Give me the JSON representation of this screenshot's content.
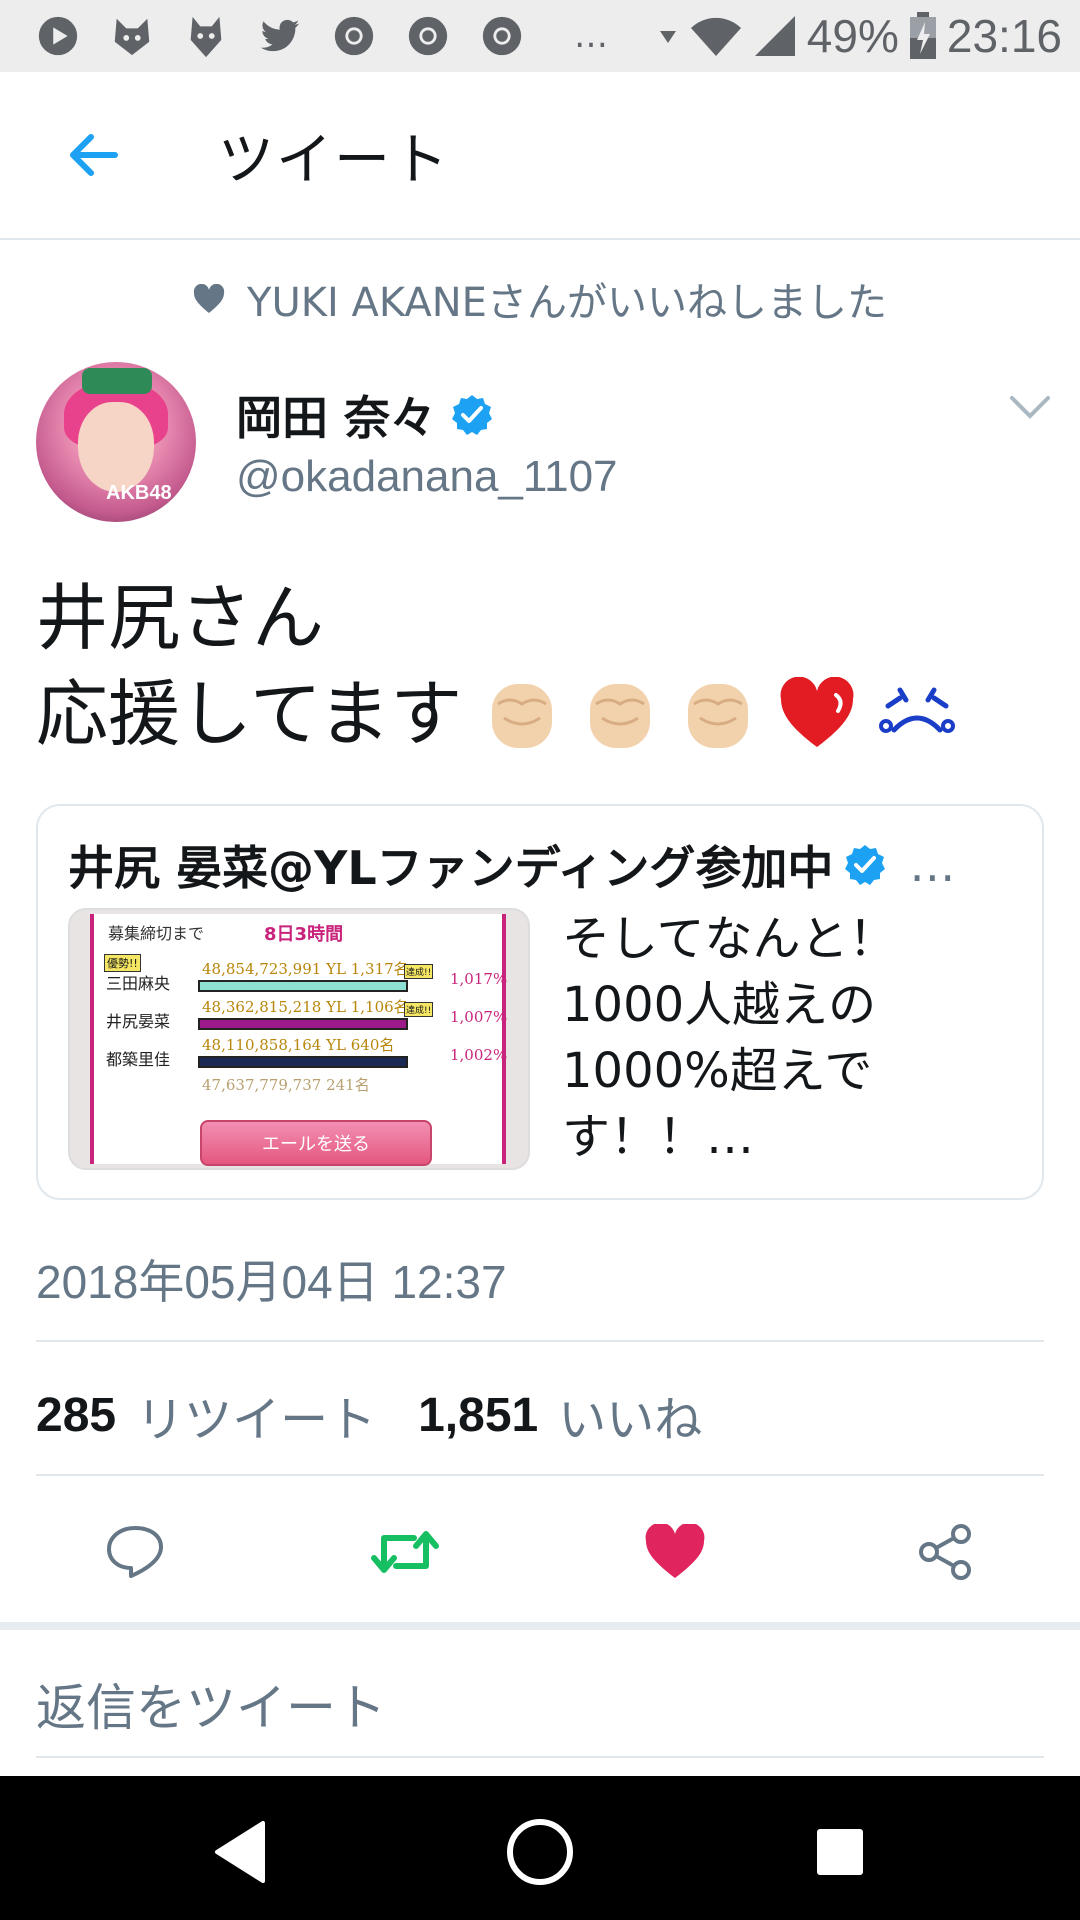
{
  "status_bar": {
    "battery": "49%",
    "time": "23:16",
    "more": "…",
    "notification_icons": [
      "play-icon",
      "cat-icon",
      "cat-icon",
      "twitter-icon",
      "chrome-icon",
      "chrome-icon",
      "chrome-icon"
    ]
  },
  "app_bar": {
    "title": "ツイート"
  },
  "liked_banner": {
    "text": "YUKI AKANEさんがいいねしました"
  },
  "author": {
    "name": "岡田 奈々",
    "handle": "@okadanana_1107",
    "avatar_text": "AKB48"
  },
  "tweet": {
    "line1": "井尻さん",
    "line2": "応援してます"
  },
  "quoted": {
    "author": "井尻 晏菜@YLファンディング参加中",
    "ellipsis": "…",
    "text_lines": [
      "そしてなんと！",
      "1000人越えの",
      "1000%超えで",
      "す！！…"
    ],
    "image": {
      "header_label": "募集締切まで",
      "header_time": "8日3時間",
      "rows": [
        {
          "name": "三田麻央",
          "amount": "48,854,723,991",
          "unit": "YL",
          "count": "1,317名",
          "pct": "1,017%",
          "badge": "優勢!!"
        },
        {
          "name": "井尻晏菜",
          "amount": "48,362,815,218",
          "unit": "YL",
          "count": "1,106名",
          "pct": "1,007%",
          "badge": ""
        },
        {
          "name": "都築里佳",
          "amount": "48,110,858,164",
          "unit": "YL",
          "count": "640名",
          "pct": "1,002%",
          "badge": ""
        }
      ],
      "tag": "達成!!",
      "partial_row": "47,637,779,737",
      "partial_count": "241名",
      "button": "エールを送る"
    }
  },
  "timestamp": "2018年05月04日 12:37",
  "stats": {
    "retweets": "285",
    "retweets_label": "リツイート",
    "likes": "1,851",
    "likes_label": "いいね"
  },
  "reply_placeholder": "返信をツイート",
  "colors": {
    "accent": "#1da1f2",
    "retweet": "#17bf63",
    "like": "#e0245e",
    "muted": "#657786"
  }
}
